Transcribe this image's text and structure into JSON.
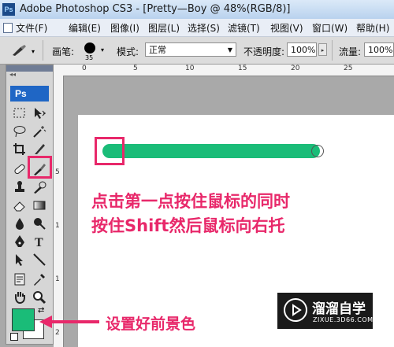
{
  "window": {
    "app_icon_text": "Ps",
    "title": "Adobe Photoshop CS3 - [Pretty—Boy @ 48%(RGB/8)]"
  },
  "menubar": {
    "items": [
      "文件(F)",
      "编辑(E)",
      "图像(I)",
      "图层(L)",
      "选择(S)",
      "滤镜(T)",
      "视图(V)",
      "窗口(W)",
      "帮助(H)"
    ]
  },
  "options_bar": {
    "brush_label": "画笔:",
    "brush_size": "35",
    "mode_label": "模式:",
    "mode_value": "正常",
    "opacity_label": "不透明度:",
    "opacity_value": "100%",
    "flow_label": "流量:",
    "flow_value": "100%"
  },
  "toolbox": {
    "logo": "Ps",
    "collapse": "◂◂"
  },
  "rulers": {
    "top": [
      "0",
      "5",
      "10",
      "15",
      "20",
      "25"
    ],
    "left": [
      "5",
      "1",
      "1",
      "2"
    ]
  },
  "annotations": {
    "line1": "点击第一点按住鼠标的同时",
    "line2": "按住Shift然后鼠标向右托",
    "color_hint": "设置好前景色"
  },
  "colors": {
    "foreground": "#1abc78",
    "background": "#ffffff",
    "annotation": "#e8286a"
  },
  "watermark": {
    "title": "溜溜自学",
    "url": "ZIXUE.3D66.COM"
  }
}
